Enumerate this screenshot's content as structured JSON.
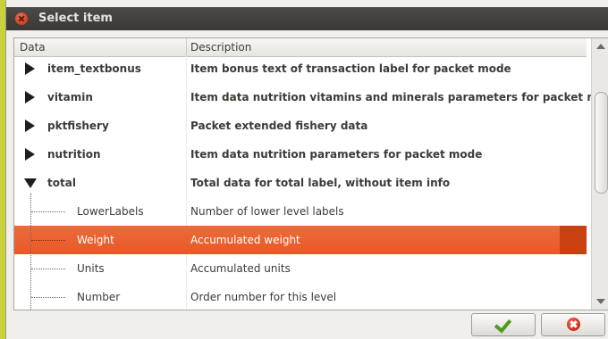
{
  "window": {
    "title": "Select item"
  },
  "columns": {
    "data": "Data",
    "description": "Description"
  },
  "rows": [
    {
      "data": "item_textbonus",
      "description": "Item bonus text of transaction label for packet mode"
    },
    {
      "data": "vitamin",
      "description": "Item data nutrition vitamins and minerals parameters for packet mode"
    },
    {
      "data": "pktfishery",
      "description": "Packet extended fishery data"
    },
    {
      "data": "nutrition",
      "description": "Item data nutrition parameters for packet mode"
    },
    {
      "data": "total",
      "description": "Total data for total label, without item info",
      "expanded": true
    },
    {
      "data": "LowerLabels",
      "description": "Number of lower level labels"
    },
    {
      "data": "Weight",
      "description": "Accumulated weight",
      "selected": true
    },
    {
      "data": "Units",
      "description": "Accumulated units"
    },
    {
      "data": "Number",
      "description": "Order number for this level"
    }
  ],
  "buttons": {
    "ok_icon": "check-icon",
    "cancel_icon": "cancel-icon"
  },
  "colors": {
    "selection": "#e55a28",
    "titlebar": "#3f3e3a",
    "background": "#c9d23a"
  }
}
